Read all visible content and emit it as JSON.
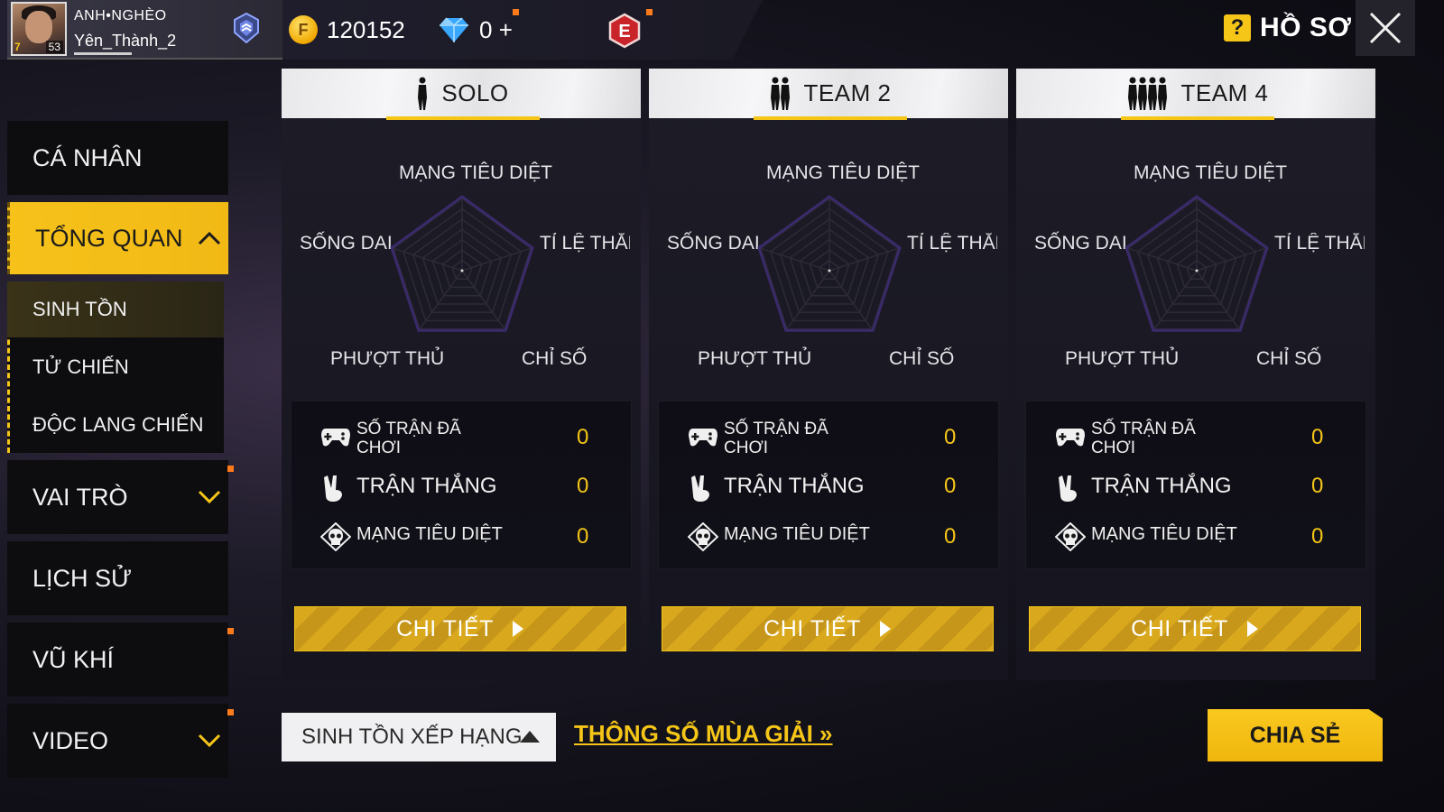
{
  "header": {
    "player": {
      "clan": "ANH•NGHÈO",
      "name": "Yên_Thành_2",
      "level": "53",
      "badge_number": "7"
    },
    "currency": {
      "gold": "120152",
      "diamonds": "0"
    },
    "add_symbol": "+",
    "help_icon": "?",
    "title": "HỒ SƠ",
    "icons": {
      "rank": "rank-badge-icon",
      "gold": "gold-coin-icon",
      "diamond": "diamond-icon",
      "elite": "elite-pass-icon",
      "close": "close-icon"
    },
    "elite_letter": "E",
    "coin_letter": "F"
  },
  "sidebar": {
    "items": [
      {
        "label": "CÁ NHÂN"
      },
      {
        "label": "TỔNG QUAN",
        "active": true,
        "sub": [
          {
            "label": "SINH TỒN",
            "selected": true
          },
          {
            "label": "TỬ CHIẾN"
          },
          {
            "label": "ĐỘC LANG CHIẾN"
          }
        ]
      },
      {
        "label": "VAI TRÒ"
      },
      {
        "label": "LỊCH SỬ"
      },
      {
        "label": "VŨ KHÍ"
      },
      {
        "label": "VIDEO"
      }
    ]
  },
  "modes": [
    {
      "title": "SOLO",
      "icon": "solo-player-icon",
      "radar": {
        "top": "MẠNG TIÊU DIỆT",
        "left": "SỐNG DAI",
        "right": "TỈ LỆ THẮNG",
        "bottom_left": "PHƯỢT THỦ",
        "bottom_right": "CHỈ SỐ"
      },
      "stats": [
        {
          "label": "SỐ TRẬN ĐÃ CHƠI",
          "value": "0"
        },
        {
          "label": "TRẬN THẮNG",
          "value": "0"
        },
        {
          "label": "MẠNG TIÊU DIỆT",
          "value": "0"
        }
      ],
      "button": "CHI TIẾT"
    },
    {
      "title": "TEAM 2",
      "icon": "duo-team-icon",
      "radar": {
        "top": "MẠNG TIÊU DIỆT",
        "left": "SỐNG DAI",
        "right": "TỈ LỆ THẮNG",
        "bottom_left": "PHƯỢT THỦ",
        "bottom_right": "CHỈ SỐ"
      },
      "stats": [
        {
          "label": "SỐ TRẬN ĐÃ CHƠI",
          "value": "0"
        },
        {
          "label": "TRẬN THẮNG",
          "value": "0"
        },
        {
          "label": "MẠNG TIÊU DIỆT",
          "value": "0"
        }
      ],
      "button": "CHI TIẾT"
    },
    {
      "title": "TEAM 4",
      "icon": "squad-team-icon",
      "radar": {
        "top": "MẠNG TIÊU DIỆT",
        "left": "SỐNG DAI",
        "right": "TỈ LỆ THẮNG",
        "bottom_left": "PHƯỢT THỦ",
        "bottom_right": "CHỈ SỐ"
      },
      "stats": [
        {
          "label": "SỐ TRẬN ĐÃ CHƠI",
          "value": "0"
        },
        {
          "label": "TRẬN THẮNG",
          "value": "0"
        },
        {
          "label": "MẠNG TIÊU DIỆT",
          "value": "0"
        }
      ],
      "button": "CHI TIẾT"
    }
  ],
  "footer": {
    "rank_select": "SINH TỒN XẾP HẠNG",
    "season_link": "THÔNG SỐ MÙA GIẢI",
    "season_link_arrow": "»",
    "share_button": "CHIA SẺ"
  },
  "colors": {
    "accent": "#f5c518",
    "notify": "#ff7a1a",
    "panel": "#16151f"
  }
}
